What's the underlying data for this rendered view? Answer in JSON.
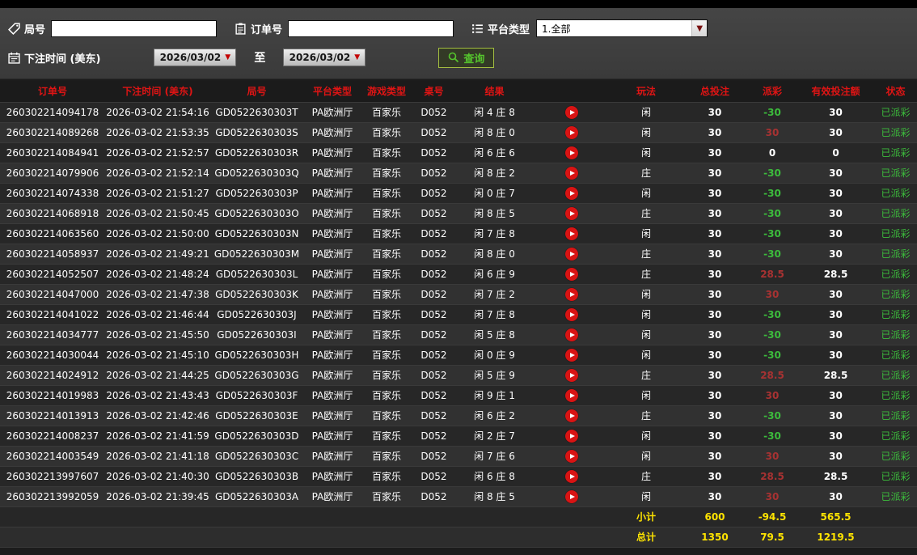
{
  "colors": {
    "header_red": "#e01414",
    "win_red": "#a83232",
    "loss_green": "#3cbb3c",
    "status_green": "#3cbb3c",
    "summary_yellow": "#ffe400",
    "play_button_red": "#d81414"
  },
  "filters": {
    "game_no": {
      "label": "局号",
      "value": "",
      "icon": "tag-icon"
    },
    "order_no": {
      "label": "订单号",
      "value": "",
      "icon": "clipboard-icon"
    },
    "platform_type": {
      "label": "平台类型",
      "selected": "1.全部",
      "icon": "list-icon"
    },
    "bet_time": {
      "label": "下注时间 (美东)",
      "icon": "calendar-icon"
    },
    "date_from": "2026/03/02",
    "to_label": "至",
    "date_to": "2026/03/02",
    "query_button": {
      "label": "查询",
      "icon": "magnifier-icon"
    }
  },
  "table": {
    "headers": [
      "订单号",
      "下注时间 (美东)",
      "局号",
      "平台类型",
      "游戏类型",
      "桌号",
      "结果",
      "",
      "玩法",
      "总投注",
      "派彩",
      "有效投注额",
      "状态"
    ],
    "rows": [
      {
        "order_no": "260302214094178",
        "bet_time": "2026-03-02 21:54:16",
        "game_no": "GD0522630303T",
        "platform": "PA欧洲厅",
        "game_type": "百家乐",
        "table_no": "D052",
        "result": "闲 4 庄 8",
        "bet_type": "闲",
        "total_bet": "30",
        "payout": "-30",
        "valid_bet": "30",
        "status": "已派彩"
      },
      {
        "order_no": "260302214089268",
        "bet_time": "2026-03-02 21:53:35",
        "game_no": "GD0522630303S",
        "platform": "PA欧洲厅",
        "game_type": "百家乐",
        "table_no": "D052",
        "result": "闲 8 庄 0",
        "bet_type": "闲",
        "total_bet": "30",
        "payout": "30",
        "valid_bet": "30",
        "status": "已派彩"
      },
      {
        "order_no": "260302214084941",
        "bet_time": "2026-03-02 21:52:57",
        "game_no": "GD0522630303R",
        "platform": "PA欧洲厅",
        "game_type": "百家乐",
        "table_no": "D052",
        "result": "闲 6 庄 6",
        "bet_type": "闲",
        "total_bet": "30",
        "payout": "0",
        "valid_bet": "0",
        "status": "已派彩"
      },
      {
        "order_no": "260302214079906",
        "bet_time": "2026-03-02 21:52:14",
        "game_no": "GD0522630303Q",
        "platform": "PA欧洲厅",
        "game_type": "百家乐",
        "table_no": "D052",
        "result": "闲 8 庄 2",
        "bet_type": "庄",
        "total_bet": "30",
        "payout": "-30",
        "valid_bet": "30",
        "status": "已派彩"
      },
      {
        "order_no": "260302214074338",
        "bet_time": "2026-03-02 21:51:27",
        "game_no": "GD0522630303P",
        "platform": "PA欧洲厅",
        "game_type": "百家乐",
        "table_no": "D052",
        "result": "闲 0 庄 7",
        "bet_type": "闲",
        "total_bet": "30",
        "payout": "-30",
        "valid_bet": "30",
        "status": "已派彩"
      },
      {
        "order_no": "260302214068918",
        "bet_time": "2026-03-02 21:50:45",
        "game_no": "GD0522630303O",
        "platform": "PA欧洲厅",
        "game_type": "百家乐",
        "table_no": "D052",
        "result": "闲 8 庄 5",
        "bet_type": "庄",
        "total_bet": "30",
        "payout": "-30",
        "valid_bet": "30",
        "status": "已派彩"
      },
      {
        "order_no": "260302214063560",
        "bet_time": "2026-03-02 21:50:00",
        "game_no": "GD0522630303N",
        "platform": "PA欧洲厅",
        "game_type": "百家乐",
        "table_no": "D052",
        "result": "闲 7 庄 8",
        "bet_type": "闲",
        "total_bet": "30",
        "payout": "-30",
        "valid_bet": "30",
        "status": "已派彩"
      },
      {
        "order_no": "260302214058937",
        "bet_time": "2026-03-02 21:49:21",
        "game_no": "GD0522630303M",
        "platform": "PA欧洲厅",
        "game_type": "百家乐",
        "table_no": "D052",
        "result": "闲 8 庄 0",
        "bet_type": "庄",
        "total_bet": "30",
        "payout": "-30",
        "valid_bet": "30",
        "status": "已派彩"
      },
      {
        "order_no": "260302214052507",
        "bet_time": "2026-03-02 21:48:24",
        "game_no": "GD0522630303L",
        "platform": "PA欧洲厅",
        "game_type": "百家乐",
        "table_no": "D052",
        "result": "闲 6 庄 9",
        "bet_type": "庄",
        "total_bet": "30",
        "payout": "28.5",
        "valid_bet": "28.5",
        "status": "已派彩"
      },
      {
        "order_no": "260302214047000",
        "bet_time": "2026-03-02 21:47:38",
        "game_no": "GD0522630303K",
        "platform": "PA欧洲厅",
        "game_type": "百家乐",
        "table_no": "D052",
        "result": "闲 7 庄 2",
        "bet_type": "闲",
        "total_bet": "30",
        "payout": "30",
        "valid_bet": "30",
        "status": "已派彩"
      },
      {
        "order_no": "260302214041022",
        "bet_time": "2026-03-02 21:46:44",
        "game_no": "GD0522630303J",
        "platform": "PA欧洲厅",
        "game_type": "百家乐",
        "table_no": "D052",
        "result": "闲 7 庄 8",
        "bet_type": "闲",
        "total_bet": "30",
        "payout": "-30",
        "valid_bet": "30",
        "status": "已派彩"
      },
      {
        "order_no": "260302214034777",
        "bet_time": "2026-03-02 21:45:50",
        "game_no": "GD0522630303I",
        "platform": "PA欧洲厅",
        "game_type": "百家乐",
        "table_no": "D052",
        "result": "闲 5 庄 8",
        "bet_type": "闲",
        "total_bet": "30",
        "payout": "-30",
        "valid_bet": "30",
        "status": "已派彩"
      },
      {
        "order_no": "260302214030044",
        "bet_time": "2026-03-02 21:45:10",
        "game_no": "GD0522630303H",
        "platform": "PA欧洲厅",
        "game_type": "百家乐",
        "table_no": "D052",
        "result": "闲 0 庄 9",
        "bet_type": "闲",
        "total_bet": "30",
        "payout": "-30",
        "valid_bet": "30",
        "status": "已派彩"
      },
      {
        "order_no": "260302214024912",
        "bet_time": "2026-03-02 21:44:25",
        "game_no": "GD0522630303G",
        "platform": "PA欧洲厅",
        "game_type": "百家乐",
        "table_no": "D052",
        "result": "闲 5 庄 9",
        "bet_type": "庄",
        "total_bet": "30",
        "payout": "28.5",
        "valid_bet": "28.5",
        "status": "已派彩"
      },
      {
        "order_no": "260302214019983",
        "bet_time": "2026-03-02 21:43:43",
        "game_no": "GD0522630303F",
        "platform": "PA欧洲厅",
        "game_type": "百家乐",
        "table_no": "D052",
        "result": "闲 9 庄 1",
        "bet_type": "闲",
        "total_bet": "30",
        "payout": "30",
        "valid_bet": "30",
        "status": "已派彩"
      },
      {
        "order_no": "260302214013913",
        "bet_time": "2026-03-02 21:42:46",
        "game_no": "GD0522630303E",
        "platform": "PA欧洲厅",
        "game_type": "百家乐",
        "table_no": "D052",
        "result": "闲 6 庄 2",
        "bet_type": "庄",
        "total_bet": "30",
        "payout": "-30",
        "valid_bet": "30",
        "status": "已派彩"
      },
      {
        "order_no": "260302214008237",
        "bet_time": "2026-03-02 21:41:59",
        "game_no": "GD0522630303D",
        "platform": "PA欧洲厅",
        "game_type": "百家乐",
        "table_no": "D052",
        "result": "闲 2 庄 7",
        "bet_type": "闲",
        "total_bet": "30",
        "payout": "-30",
        "valid_bet": "30",
        "status": "已派彩"
      },
      {
        "order_no": "260302214003549",
        "bet_time": "2026-03-02 21:41:18",
        "game_no": "GD0522630303C",
        "platform": "PA欧洲厅",
        "game_type": "百家乐",
        "table_no": "D052",
        "result": "闲 7 庄 6",
        "bet_type": "闲",
        "total_bet": "30",
        "payout": "30",
        "valid_bet": "30",
        "status": "已派彩"
      },
      {
        "order_no": "260302213997607",
        "bet_time": "2026-03-02 21:40:30",
        "game_no": "GD0522630303B",
        "platform": "PA欧洲厅",
        "game_type": "百家乐",
        "table_no": "D052",
        "result": "闲 6 庄 8",
        "bet_type": "庄",
        "total_bet": "30",
        "payout": "28.5",
        "valid_bet": "28.5",
        "status": "已派彩"
      },
      {
        "order_no": "260302213992059",
        "bet_time": "2026-03-02 21:39:45",
        "game_no": "GD0522630303A",
        "platform": "PA欧洲厅",
        "game_type": "百家乐",
        "table_no": "D052",
        "result": "闲 8 庄 5",
        "bet_type": "闲",
        "total_bet": "30",
        "payout": "30",
        "valid_bet": "30",
        "status": "已派彩"
      }
    ],
    "subtotal": {
      "label": "小计",
      "total_bet": "600",
      "payout": "-94.5",
      "valid_bet": "565.5"
    },
    "grand_total": {
      "label": "总计",
      "total_bet": "1350",
      "payout": "79.5",
      "valid_bet": "1219.5"
    }
  }
}
